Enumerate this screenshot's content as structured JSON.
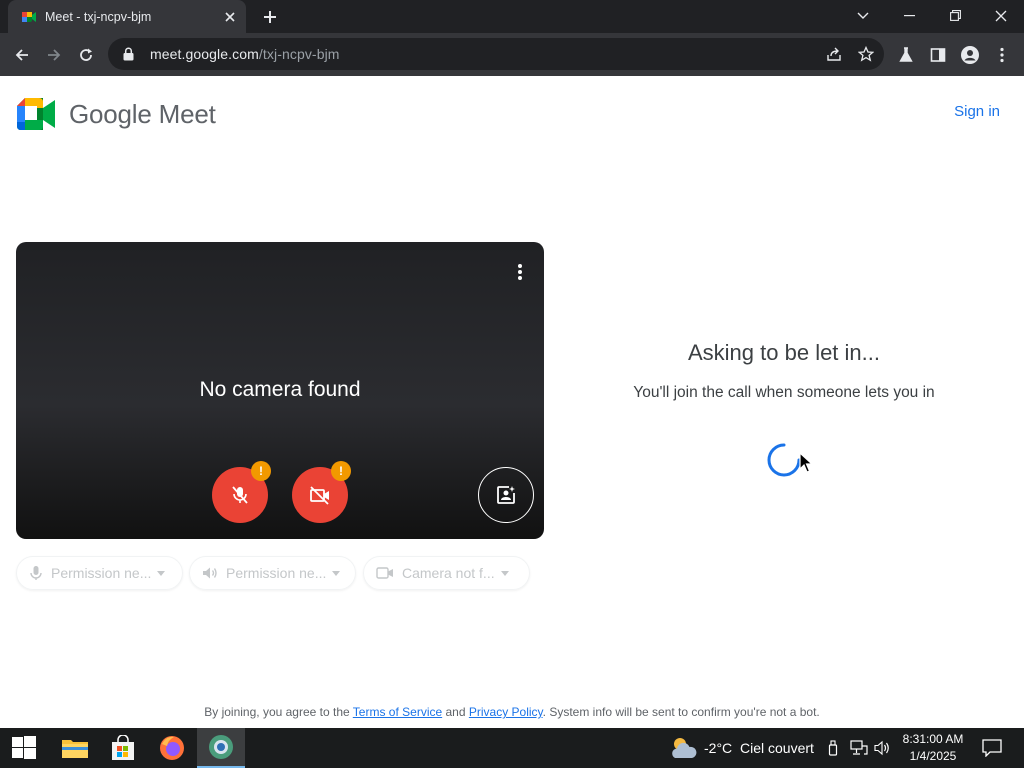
{
  "browser": {
    "tab_title": "Meet - txj-ncpv-bjm",
    "url_host": "meet.google.com",
    "url_path": "/txj-ncpv-bjm"
  },
  "header": {
    "logo_text": "Google Meet",
    "sign_in": "Sign in"
  },
  "preview": {
    "message": "No camera found"
  },
  "chips": [
    {
      "label": "Permission ne...",
      "icon": "mic-icon"
    },
    {
      "label": "Permission ne...",
      "icon": "speaker-icon"
    },
    {
      "label": "Camera not f...",
      "icon": "camera-icon"
    }
  ],
  "waiting": {
    "title": "Asking to be let in...",
    "subtitle": "You'll join the call when someone lets you in"
  },
  "footer": {
    "prefix": "By joining, you agree to the ",
    "terms": "Terms of Service",
    "middle": " and ",
    "privacy": "Privacy Policy",
    "suffix": ". System info will be sent to confirm you're not a bot."
  },
  "taskbar": {
    "temperature": "-2°C",
    "weather": "Ciel couvert",
    "time": "8:31:00 AM",
    "date": "1/4/2025"
  },
  "colors": {
    "accent": "#1a73e8",
    "danger": "#ea4335",
    "warning": "#f29900"
  }
}
